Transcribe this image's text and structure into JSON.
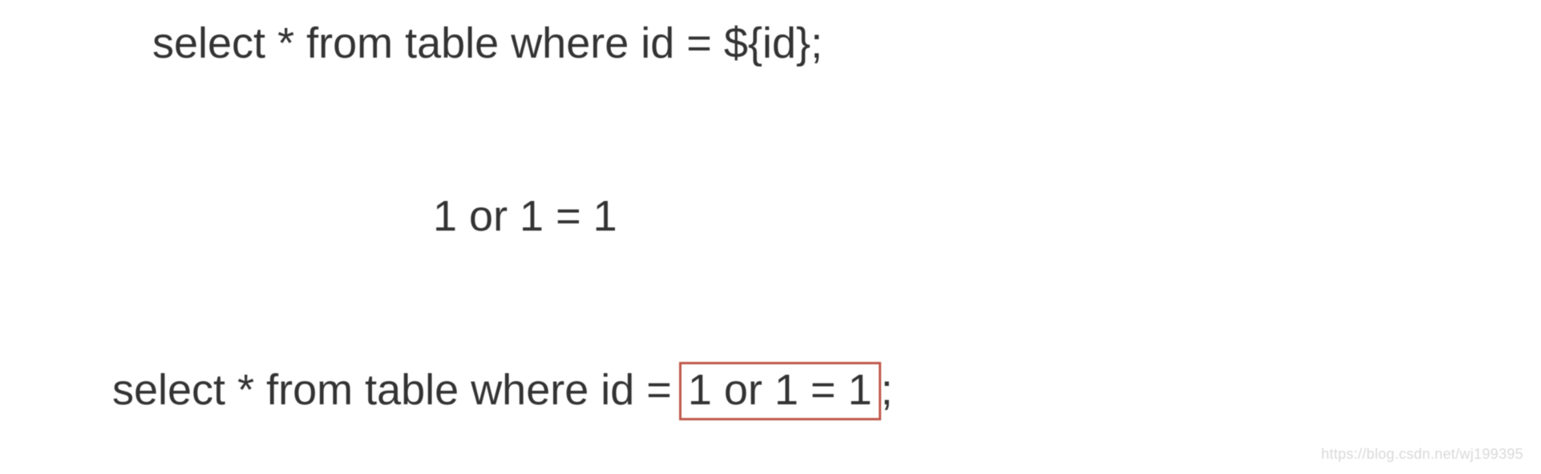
{
  "lines": {
    "line1": "select * from table where id = ${id};",
    "line2": "1 or 1 = 1",
    "line3_prefix": "select * from table where id = ",
    "line3_highlight": "1 or 1 = 1",
    "line3_suffix": ";"
  },
  "watermark": "https://blog.csdn.net/wj199395"
}
